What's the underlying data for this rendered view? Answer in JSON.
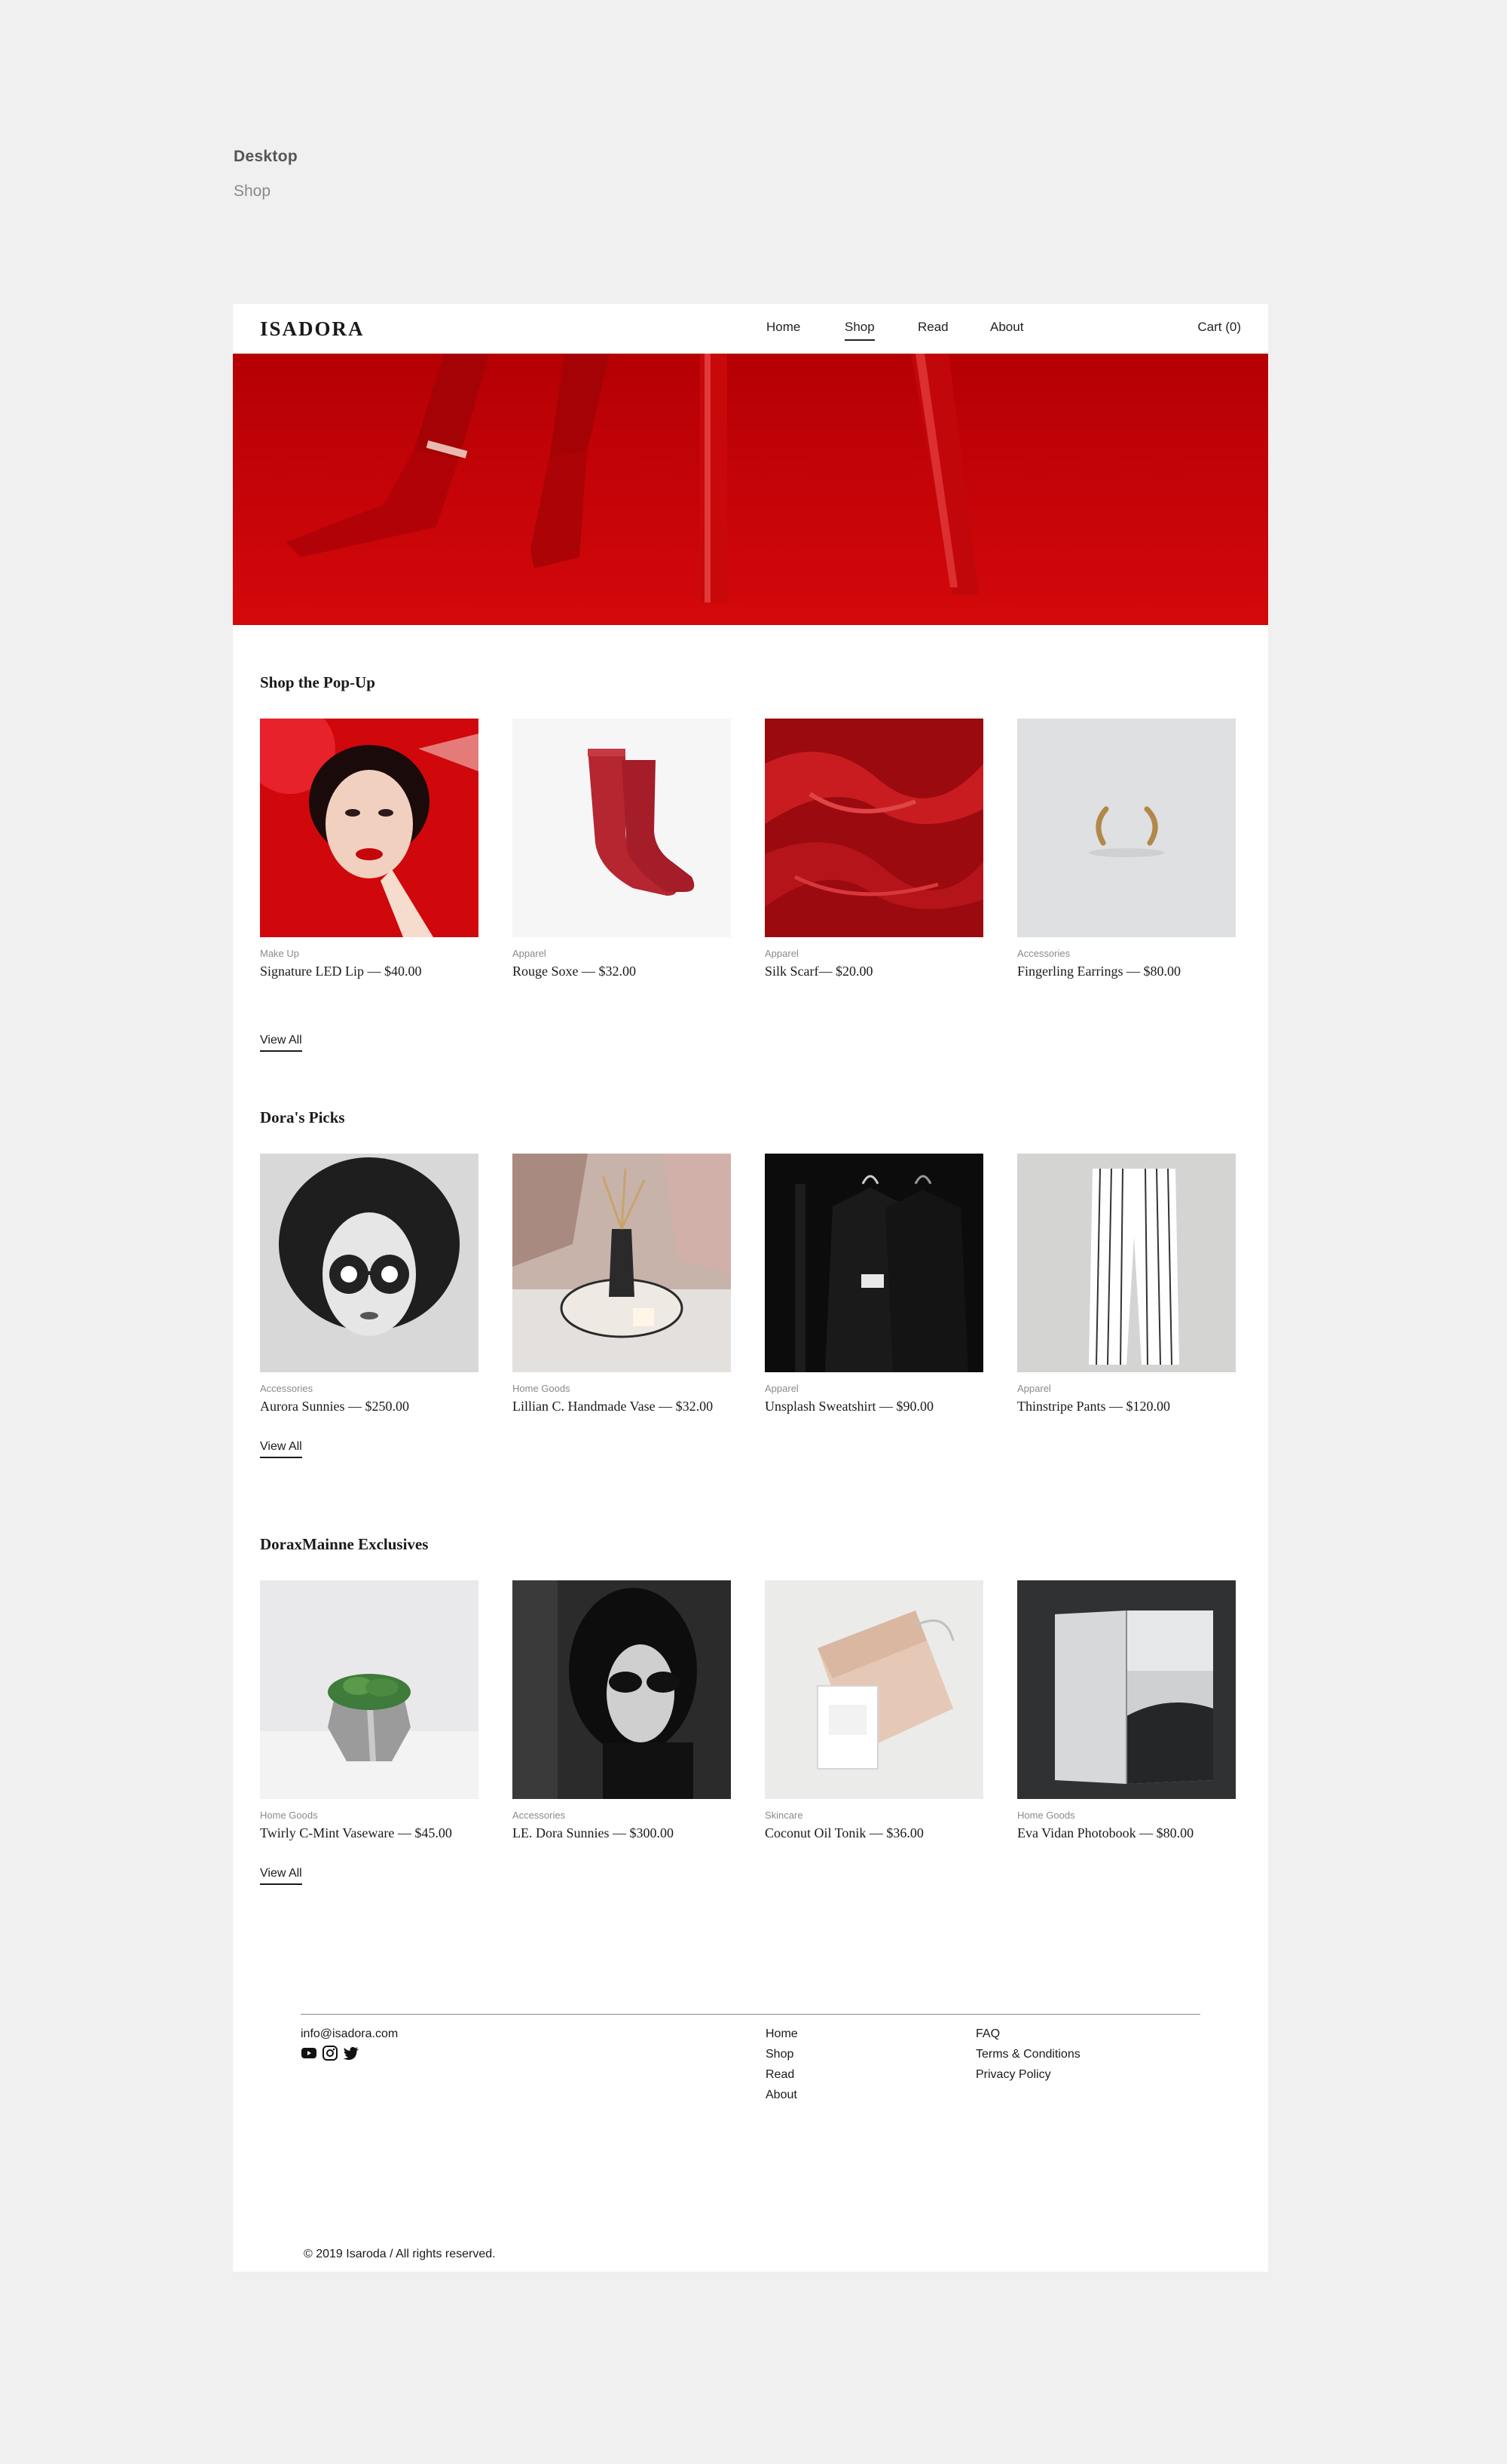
{
  "presentation": {
    "title": "Desktop",
    "subtitle": "Shop"
  },
  "header": {
    "logo": "ISADORA",
    "nav": [
      "Home",
      "Shop",
      "Read",
      "About"
    ],
    "active": "Shop",
    "cart": "Cart (0)"
  },
  "sections": [
    {
      "title": "Shop the Pop-Up",
      "view_all": "View All",
      "products": [
        {
          "category": "Make Up",
          "name": "Signature LED Lip — $40.00"
        },
        {
          "category": "Apparel",
          "name": "Rouge Soxe — $32.00"
        },
        {
          "category": "Apparel",
          "name": "Silk Scarf— $20.00"
        },
        {
          "category": "Accessories",
          "name": "Fingerling Earrings — $80.00"
        }
      ]
    },
    {
      "title": "Dora's Picks",
      "view_all": "View All",
      "products": [
        {
          "category": "Accessories",
          "name": "Aurora Sunnies — $250.00"
        },
        {
          "category": "Home Goods",
          "name": "Lillian C. Handmade Vase — $32.00"
        },
        {
          "category": "Apparel",
          "name": "Unsplash Sweatshirt — $90.00"
        },
        {
          "category": "Apparel",
          "name": "Thinstripe Pants — $120.00"
        }
      ]
    },
    {
      "title": "DoraxMainne Exclusives",
      "view_all": "View All",
      "products": [
        {
          "category": "Home Goods",
          "name": "Twirly C-Mint Vaseware — $45.00"
        },
        {
          "category": "Accessories",
          "name": "LE. Dora Sunnies — $300.00"
        },
        {
          "category": "Skincare",
          "name": "Coconut Oil Tonik — $36.00"
        },
        {
          "category": "Home Goods",
          "name": "Eva Vidan Photobook — $80.00"
        }
      ]
    }
  ],
  "footer": {
    "email": "info@isadora.com",
    "social_icons": [
      "youtube-icon",
      "instagram-icon",
      "twitter-icon"
    ],
    "links_col1": [
      "Home",
      "Shop",
      "Read",
      "About"
    ],
    "links_col2": [
      "FAQ",
      "Terms & Conditions",
      "Privacy Policy"
    ],
    "copyright": "© 2019 Isaroda / All rights reserved."
  },
  "colors": {
    "accent_red": "#c4070a",
    "text": "#1a1a1a",
    "muted": "#8a8a8a",
    "canvas": "#f0f0f0"
  }
}
